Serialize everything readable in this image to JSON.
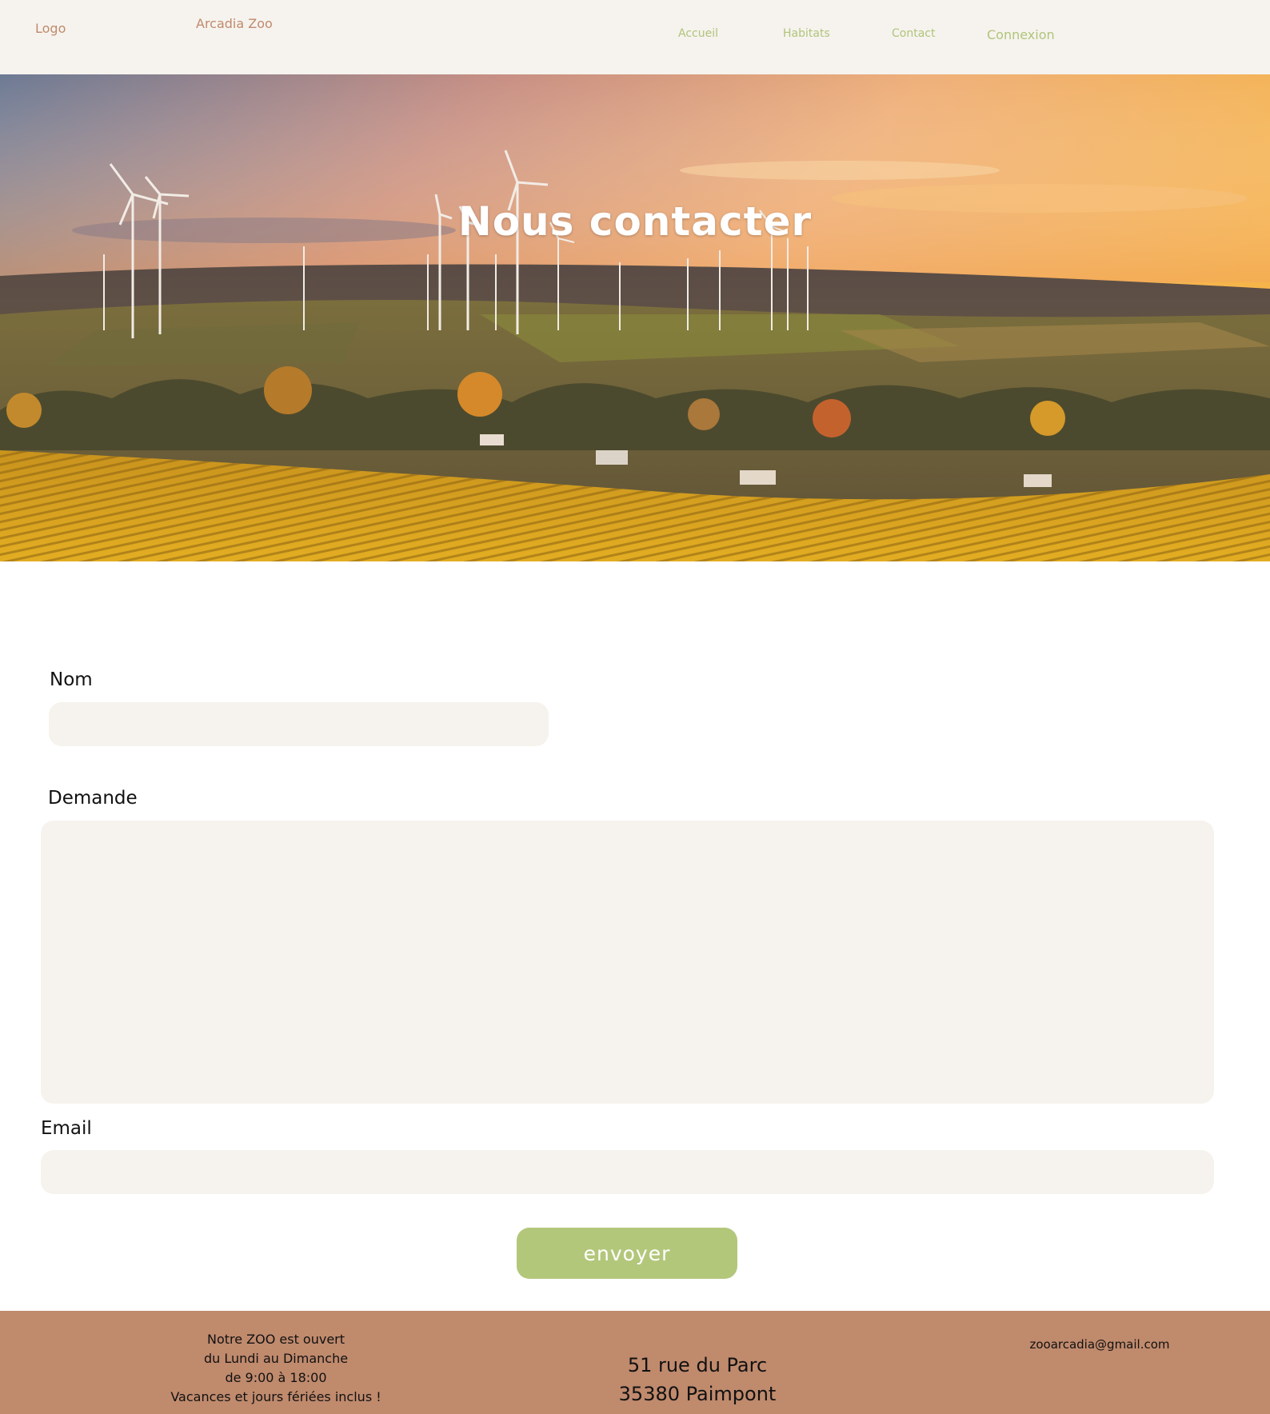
{
  "header": {
    "logo": "Logo",
    "brand": "Arcadia Zoo",
    "nav": {
      "accueil": "Accueil",
      "habitats": "Habitats",
      "contact": "Contact",
      "connexion": "Connexion"
    }
  },
  "hero": {
    "title": "Nous contacter"
  },
  "form": {
    "nom_label": "Nom",
    "nom_value": "",
    "demande_label": "Demande",
    "demande_value": "",
    "email_label": "Email",
    "email_value": "",
    "submit_label": "envoyer"
  },
  "footer": {
    "hours_line1": "Notre ZOO est ouvert",
    "hours_line2": "du Lundi au Dimanche",
    "hours_line3": "de 9:00 à 18:00",
    "hours_line4": "Vacances et jours fériées inclus !",
    "address_line1": "51 rue du Parc",
    "address_line2": "35380 Paimpont",
    "email": "zooarcadia@gmail.com"
  },
  "colors": {
    "header_bg": "#f6f3ee",
    "brand_text": "#c08a6d",
    "nav_text": "#b0c47a",
    "field_bg": "#f6f3ee",
    "button_bg": "#b3c77b",
    "footer_bg": "#c08a6d"
  }
}
